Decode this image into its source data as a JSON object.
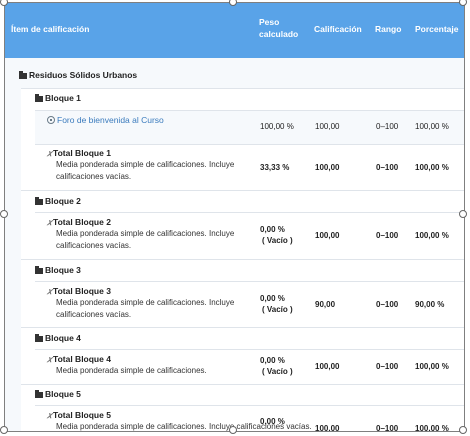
{
  "header": {
    "col_item": "Ítem de calificación",
    "col_weight_line1": "Peso",
    "col_weight_line2": "calculado",
    "col_grade": "Calificación",
    "col_range": "Rango",
    "col_percent": "Porcentaje"
  },
  "course": {
    "name": "Residuos Sólidos Urbanos",
    "icon": "folder-icon"
  },
  "blocks": [
    {
      "name": "Bloque 1"
    },
    {
      "name": "Bloque 2"
    },
    {
      "name": "Bloque 3"
    },
    {
      "name": "Bloque 4"
    },
    {
      "name": "Bloque 5"
    }
  ],
  "forum_item": {
    "title": "Foro de bienvenida al Curso",
    "weight": "100,00 %",
    "grade": "100,00",
    "range": "0–100",
    "percent": "100,00 %",
    "icon": "forum-icon"
  },
  "totals": [
    {
      "title": "Total Bloque 1",
      "desc": "Media ponderada simple de calificaciones. Incluye calificaciones vacías.",
      "weight": "33,33 %",
      "weight_note": "",
      "grade": "100,00",
      "range": "0–100",
      "percent": "100,00 %"
    },
    {
      "title": "Total Bloque 2",
      "desc": "Media ponderada simple de calificaciones. Incluye calificaciones vacías.",
      "weight": "0,00 %",
      "weight_note": "( Vacío )",
      "grade": "100,00",
      "range": "0–100",
      "percent": "100,00 %"
    },
    {
      "title": "Total Bloque 3",
      "desc": "Media ponderada simple de calificaciones. Incluye calificaciones vacías.",
      "weight": "0,00 %",
      "weight_note": "( Vacío )",
      "grade": "90,00",
      "range": "0–100",
      "percent": "90,00 %"
    },
    {
      "title": "Total Bloque 4",
      "desc": "Media ponderada simple de calificaciones.",
      "weight": "0,00 %",
      "weight_note": "( Vacío )",
      "grade": "100,00",
      "range": "0–100",
      "percent": "100,00 %"
    },
    {
      "title": "Total Bloque 5",
      "desc": "Media ponderada simple de calificaciones. Incluye calificaciones vacías.",
      "weight": "0,00 %",
      "weight_note": "",
      "grade": "100,00",
      "range": "0–100",
      "percent": "100,00 %"
    }
  ],
  "colors": {
    "header_bg": "#59a3e8",
    "link": "#3a7bbd"
  }
}
